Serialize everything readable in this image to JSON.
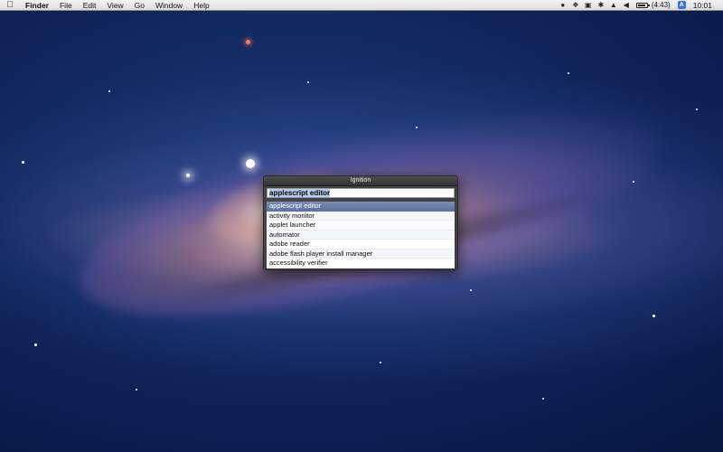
{
  "menubar": {
    "apple_icon": "apple-logo-icon",
    "app_name": "Finder",
    "items": [
      "File",
      "Edit",
      "View",
      "Go",
      "Window",
      "Help"
    ],
    "status_icons": [
      "camera-icon",
      "dropbox-icon",
      "lock-icon",
      "bluetooth-icon",
      "wifi-icon",
      "volume-icon"
    ],
    "battery_text": "(4:43)",
    "user_badge": "A",
    "clock": "10:01"
  },
  "ignition": {
    "title": "Ignition",
    "query": "applescript editor",
    "results": [
      "applescript editor",
      "activity monitor",
      "applet launcher",
      "automator",
      "adobe reader",
      "adobe flash player install manager",
      "accessibility verifier"
    ],
    "selected_index": 0
  },
  "colors": {
    "selection": "#5d72a0",
    "text_highlight": "#b4cdf2"
  }
}
